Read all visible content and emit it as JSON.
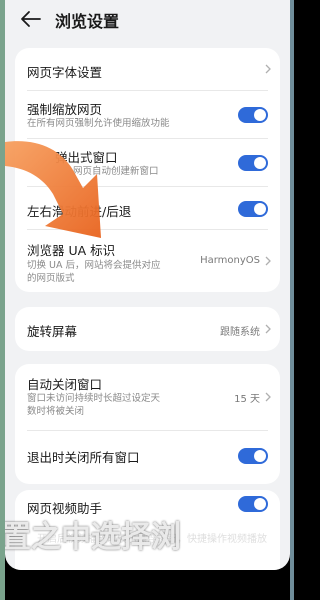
{
  "header": {
    "title": "浏览设置"
  },
  "rows": {
    "font": {
      "label": "网页字体设置"
    },
    "zoom": {
      "label": "强制缩放网页",
      "sub": "在所有网页强制允许使用缩放功能"
    },
    "popup": {
      "label": "弹出式窗口",
      "sub": "网页自动创建新窗口"
    },
    "swipe": {
      "label": "左右滑动前进/后退"
    },
    "ua": {
      "label": "浏览器 UA 标识",
      "sub1": "切换 UA 后，网站将会提供对应",
      "sub2": "的网页版式",
      "value": "HarmonyOS"
    },
    "rotate": {
      "label": "旋转屏幕",
      "value": "跟随系统"
    },
    "autoclose": {
      "label": "自动关闭窗口",
      "sub1": "窗口未访问持续时长超过设定天",
      "sub2": "数时将被关闭",
      "value": "15 天"
    },
    "exitclose": {
      "label": "退出时关闭所有窗口"
    },
    "video": {
      "label": "网页视频助手"
    }
  },
  "overlay": {
    "caption": "置之中选择浏",
    "caption_small": "开启后视频播放时展示悬浮按钮，快捷操作视频播放"
  },
  "colors": {
    "toggle_on": "#2f6ad9",
    "arrow": "#f07a2a"
  }
}
